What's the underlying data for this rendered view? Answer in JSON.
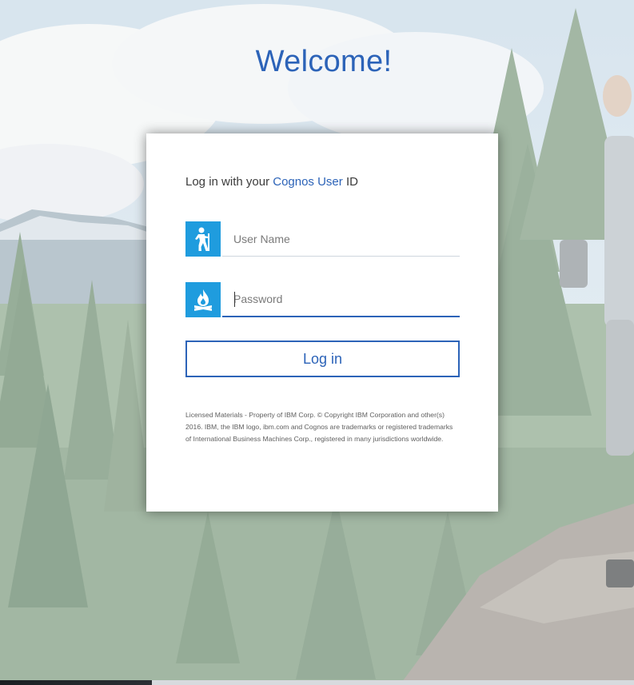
{
  "welcome_title": "Welcome!",
  "login": {
    "subtitle_prefix": "Log in with your ",
    "subtitle_brand": "Cognos User",
    "subtitle_suffix": " ID",
    "username": {
      "placeholder": "User Name",
      "value": "",
      "icon": "hiker-icon"
    },
    "password": {
      "placeholder": "Password",
      "value": "",
      "icon": "campfire-icon"
    },
    "button_label": "Log in",
    "legal_text": "Licensed Materials - Property of IBM Corp. © Copyright IBM Corporation and other(s) 2016. IBM, the IBM logo, ibm.com and Cognos are trademarks or registered trademarks of International Business Machines Corp., registered in many jurisdictions worldwide."
  },
  "colors": {
    "accent": "#2c63b8",
    "icon_bg": "#1f9cde",
    "card_bg": "#ffffff"
  }
}
